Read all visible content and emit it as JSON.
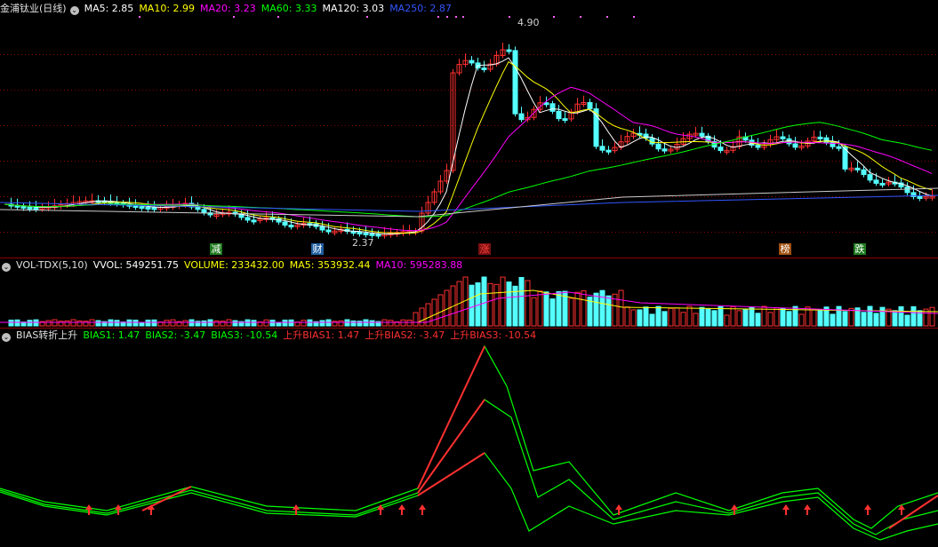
{
  "price_panel": {
    "stock_name": "金浦钛业(日线)",
    "ma_labels": [
      {
        "text": "MA5: 2.85",
        "color": "#ffffff"
      },
      {
        "text": "MA10: 2.99",
        "color": "#ffff00"
      },
      {
        "text": "MA20: 3.23",
        "color": "#ff00ff"
      },
      {
        "text": "MA60: 3.33",
        "color": "#00ff00"
      },
      {
        "text": "MA120: 3.03",
        "color": "#ffffff"
      },
      {
        "text": "MA250: 2.87",
        "color": "#3355ff"
      }
    ],
    "high_label": "4.90",
    "low_label": "2.37",
    "event_markers": [
      "减",
      "财",
      "涨",
      "榜",
      "跌"
    ],
    "event_colors": [
      "#ffffff",
      "#ffffff",
      "#ff4040",
      "#ffffff",
      "#ffffff"
    ],
    "event_bg": [
      "#1f7a1f",
      "#1f5f9f",
      "#7a1010",
      "#a05010",
      "#1f7a1f"
    ]
  },
  "volume_panel": {
    "title": "VOL-TDX(5,10)",
    "labels": [
      {
        "text": "VVOL: 549251.75",
        "color": "#ffffff"
      },
      {
        "text": "VOLUME: 233432.00",
        "color": "#ffff00"
      },
      {
        "text": "MA5: 353932.44",
        "color": "#ffff00"
      },
      {
        "text": "MA10: 595283.88",
        "color": "#ff00ff"
      }
    ]
  },
  "bias_panel": {
    "title": "BIAS转折上升",
    "labels": [
      {
        "text": "BIAS1: 1.47",
        "color": "#00ff00"
      },
      {
        "text": "BIAS2: -3.47",
        "color": "#00ff00"
      },
      {
        "text": "BIAS3: -10.54",
        "color": "#00ff00"
      },
      {
        "text": "上升BIAS1: 1.47",
        "color": "#ff3030"
      },
      {
        "text": "上升BIAS2: -3.47",
        "color": "#ff3030"
      },
      {
        "text": "上升BIAS3: -10.54",
        "color": "#ff3030"
      }
    ]
  },
  "colors": {
    "up": "#ff3030",
    "down": "#54ffff",
    "grid": "#8b0000"
  }
}
